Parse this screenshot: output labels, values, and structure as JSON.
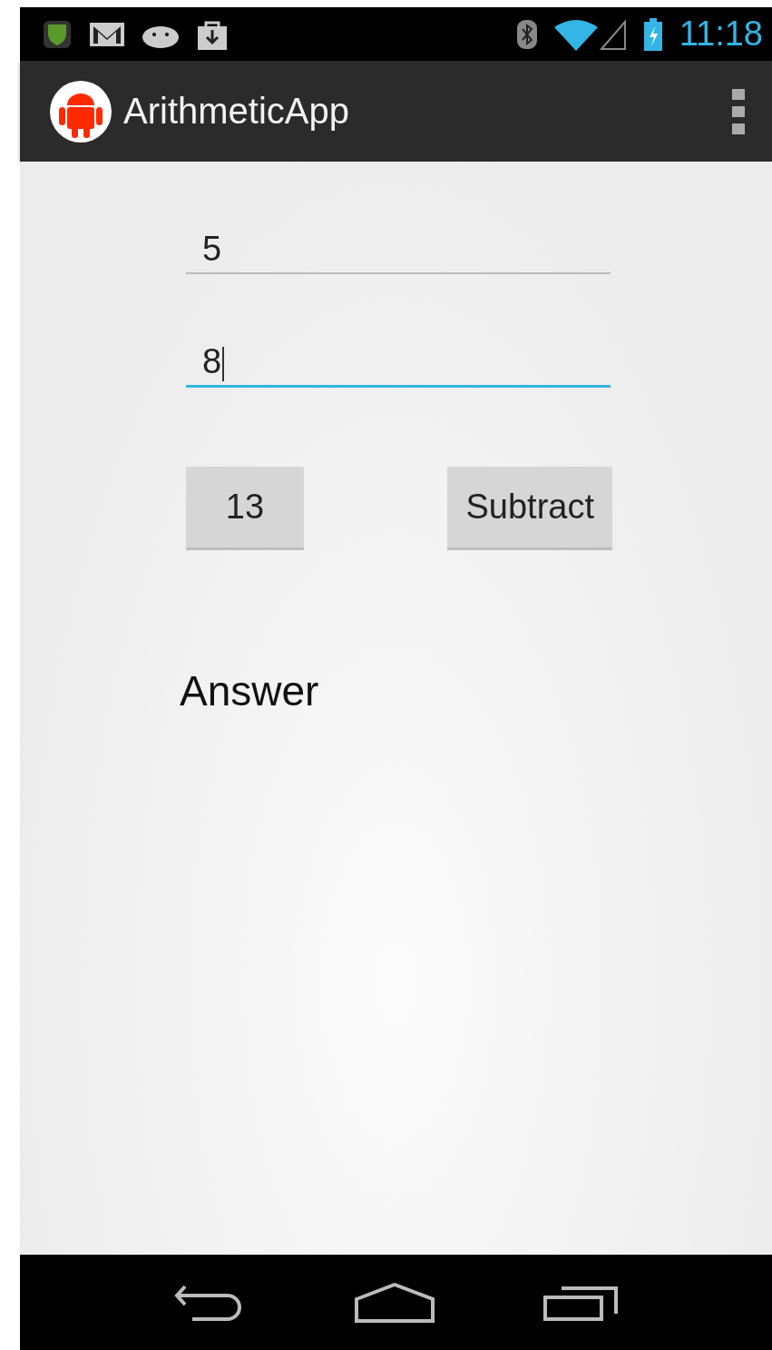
{
  "status_bar": {
    "time": "11:18"
  },
  "action_bar": {
    "title": "ArithmeticApp"
  },
  "fields": [
    {
      "value": "5",
      "focused": false
    },
    {
      "value": "8",
      "focused": true
    }
  ],
  "buttons": [
    "13",
    "Subtract"
  ],
  "answer": "Answer"
}
